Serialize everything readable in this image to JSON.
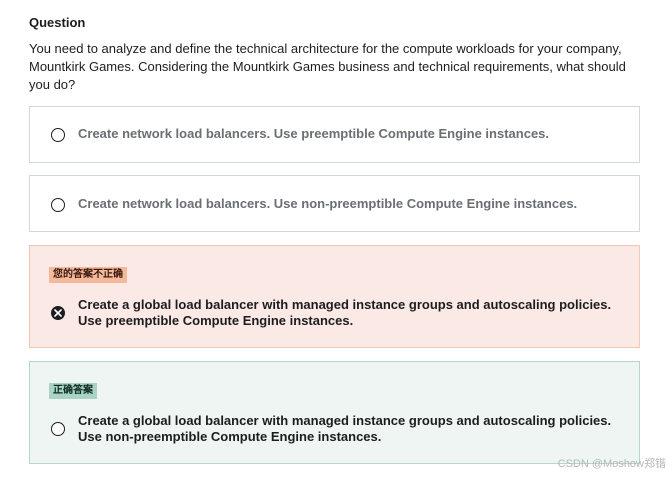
{
  "question": {
    "heading": "Question",
    "text": "You need to analyze and define the technical architecture for the compute workloads for your company, Mountkirk Games. Considering the Mountkirk Games business and technical requirements, what should you do?"
  },
  "options": [
    {
      "text": "Create network load balancers. Use preemptible Compute Engine instances.",
      "state": "unselected"
    },
    {
      "text": "Create network load balancers. Use non-preemptible Compute Engine instances.",
      "state": "unselected"
    },
    {
      "badge": "您的答案不正确",
      "line1": "Create a global load balancer with managed instance groups and autoscaling policies.",
      "line2": "Use preemptible Compute Engine instances.",
      "state": "incorrect"
    },
    {
      "badge": "正确答案",
      "line1": "Create a global load balancer with managed instance groups and autoscaling policies.",
      "line2": "Use non-preemptible Compute Engine instances.",
      "state": "correct"
    }
  ],
  "watermark": "CSDN @Moshow郑锴",
  "colors": {
    "incorrect_bg": "#fbe9e6",
    "incorrect_badge": "#f4b89a",
    "correct_bg": "#eef5f3",
    "correct_badge": "#a9d3c4"
  }
}
